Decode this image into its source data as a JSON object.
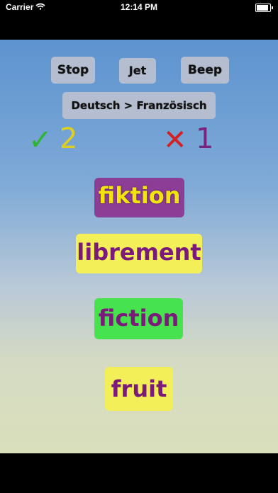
{
  "status_bar": {
    "carrier": "Carrier",
    "time": "12:14 PM"
  },
  "controls": {
    "stop_label": "Stop",
    "jet_label": "Jet",
    "beep_label": "Beep",
    "language_label": "Deutsch > Französisch"
  },
  "score": {
    "correct": "2",
    "wrong": "1",
    "correct_color": "#2fb531",
    "wrong_color": "#d42020"
  },
  "words": [
    {
      "text": "fiktion",
      "bg_color": "#8c3d95",
      "text_color": "#f2e50e"
    },
    {
      "text": "librement",
      "bg_color": "#f3ef58",
      "text_color": "#7a1b7c"
    },
    {
      "text": "fiction",
      "bg_color": "#47e34f",
      "text_color": "#7a1b7c"
    },
    {
      "text": "fruit",
      "bg_color": "#f3ef58",
      "text_color": "#7a1b7c"
    }
  ]
}
